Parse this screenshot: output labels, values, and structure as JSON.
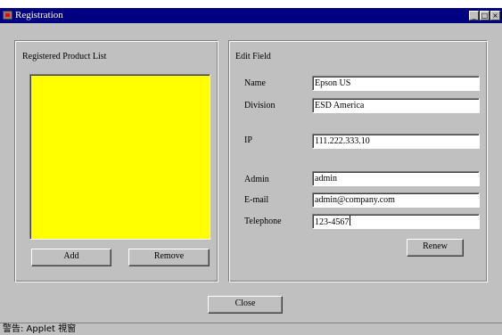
{
  "window": {
    "title": "Registration",
    "controls": {
      "minimize": "_",
      "maximize": "□",
      "close": "×"
    }
  },
  "left_panel": {
    "title": "Registered Product List",
    "list_color": "#ffff00",
    "add_label": "Add",
    "remove_label": "Remove"
  },
  "right_panel": {
    "title": "Edit Field",
    "fields": {
      "name": {
        "label": "Name",
        "value": "Epson US"
      },
      "division": {
        "label": "Division",
        "value": "ESD America"
      },
      "ip": {
        "label": "IP",
        "value": "111.222.333.10"
      },
      "admin": {
        "label": "Admin",
        "value": "admin"
      },
      "email": {
        "label": "E-mail",
        "value": "admin@company.com"
      },
      "telephone": {
        "label": "Telephone",
        "value": "123-4567"
      }
    },
    "renew_label": "Renew"
  },
  "footer": {
    "close_label": "Close",
    "status": "警告: Applet 視窗"
  },
  "colors": {
    "titlebar": "#000080",
    "face": "#c0c0c0",
    "list_background": "#ffff00"
  }
}
